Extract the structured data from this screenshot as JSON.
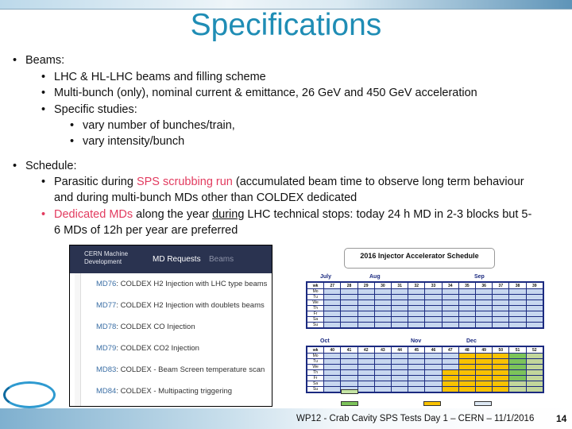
{
  "title": "Specifications",
  "beams": {
    "label": "Beams:",
    "items": [
      "LHC & HL-LHC beams and filling scheme",
      "Multi-bunch (only), nominal current & emittance, 26 GeV and 450 GeV acceleration",
      "Specific studies:"
    ],
    "sub": [
      "vary number of bunches/train,",
      "vary intensity/bunch"
    ]
  },
  "schedule": {
    "label": "Schedule:",
    "item1": {
      "a": "Parasitic during ",
      "b": "SPS scrubbing run",
      "c": " (accumulated beam time to observe long term behaviour",
      "d": "and during multi-bunch MDs other than COLDEX dedicated"
    },
    "item2": {
      "a": "Dedicated MDs",
      "b": " along the year ",
      "c": "during",
      "d": " LHC technical stops: today 24 h MD in 2-3 blocks but 5-",
      "e": "6 MDs of 12h per year are preferred"
    }
  },
  "md_requests": {
    "logo": "CERN Machine Development",
    "tabs": [
      "MD Requests",
      "Beams"
    ],
    "rows": [
      {
        "id": "MD76",
        "text": ": COLDEX   H2 Injection with LHC type beams"
      },
      {
        "id": "MD77",
        "text": ": COLDEX   H2 Injection with doublets beams"
      },
      {
        "id": "MD78",
        "text": ": COLDEX   CO Injection"
      },
      {
        "id": "MD79",
        "text": ": COLDEX   CO2 Injection"
      },
      {
        "id": "MD83",
        "text": ": COLDEX - Beam Screen temperature scan"
      },
      {
        "id": "MD84",
        "text": ": COLDEX - Multipacting triggering"
      }
    ]
  },
  "injector_schedule": {
    "title": "2016 Injector Accelerator Schedule",
    "days": [
      "Mo",
      "Tu",
      "We",
      "Th",
      "Fr",
      "Sa",
      "Su"
    ],
    "wk_label": "wk",
    "top": {
      "months": [
        "July",
        "Aug",
        "Sep"
      ],
      "weeks": [
        27,
        28,
        29,
        30,
        31,
        32,
        33,
        34,
        35,
        36,
        37,
        38,
        39
      ]
    },
    "bottom": {
      "months": [
        "Oct",
        "Nov",
        "Dec"
      ],
      "weeks": [
        40,
        41,
        42,
        43,
        44,
        45,
        46,
        47,
        48,
        49,
        50,
        51,
        52
      ]
    },
    "colors": {
      "block": "#c5e5a5",
      "stop": "#7cc35a",
      "ion": "#f9c200",
      "north": "#c7d7ef",
      "highlight": "#e0409a"
    }
  },
  "footer": "WP12 - Crab Cavity SPS Tests Day 1 – CERN – 11/1/2016",
  "page": "14",
  "logo": "HiLumi"
}
